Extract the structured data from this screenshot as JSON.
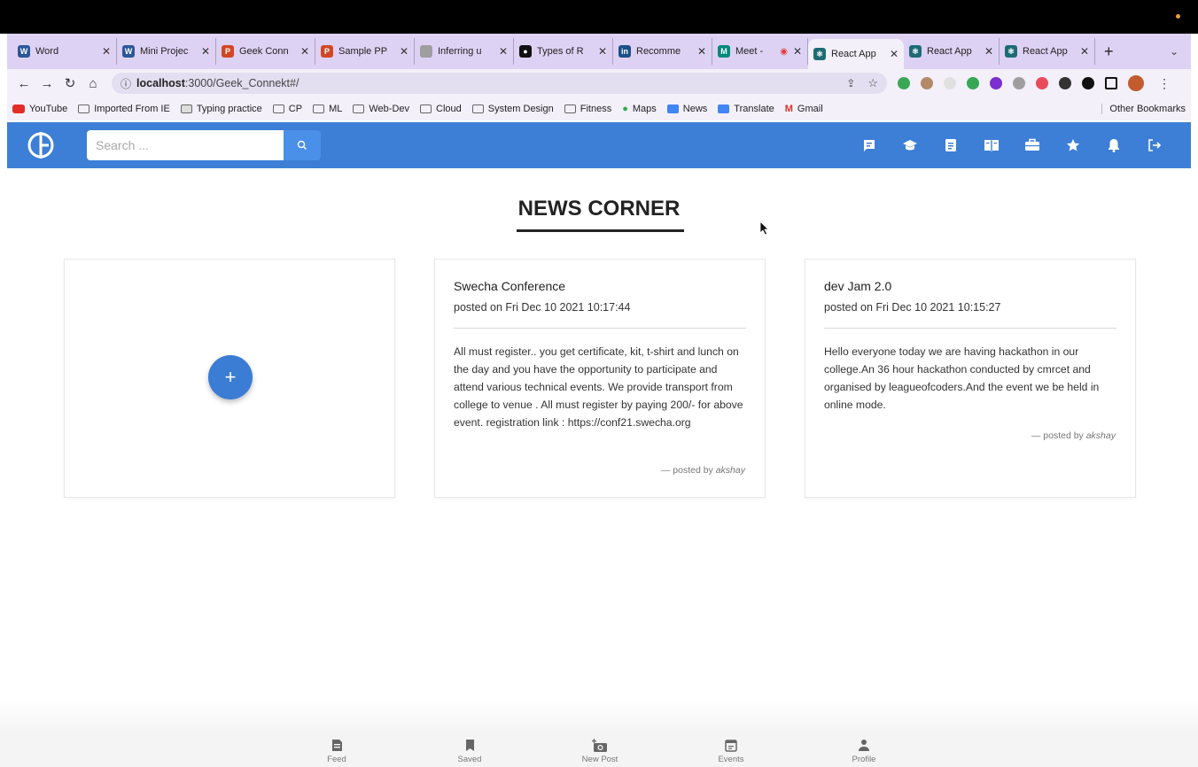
{
  "browser": {
    "tabs": [
      {
        "label": "Word",
        "color": "#2b579a",
        "letter": "W"
      },
      {
        "label": "Mini Projec",
        "color": "#2b579a",
        "letter": "W"
      },
      {
        "label": "Geek Conn",
        "color": "#d24726",
        "letter": "P"
      },
      {
        "label": "Sample PP",
        "color": "#d24726",
        "letter": "P"
      },
      {
        "label": "Inferring u",
        "color": "#888888",
        "letter": ""
      },
      {
        "label": "Types of R",
        "color": "#111111",
        "letter": "▪"
      },
      {
        "label": "Recomme",
        "color": "#1a4f8b",
        "letter": "in"
      },
      {
        "label": "Meet - ",
        "color": "#00897b",
        "letter": "M"
      },
      {
        "label": "React App",
        "color": "#1e6b75",
        "letter": "⚛",
        "active": true
      },
      {
        "label": "React App",
        "color": "#1e6b75",
        "letter": "⚛"
      },
      {
        "label": "React App",
        "color": "#1e6b75",
        "letter": "⚛"
      }
    ],
    "tab_close": "✕",
    "new_tab": "+",
    "url_host": "localhost",
    "url_path": ":3000/Geek_Connekt#/",
    "bookmarks": [
      "YouTube",
      "Imported From IE",
      "Typing practice",
      "CP",
      "ML",
      "Web-Dev",
      "Cloud",
      "System Design",
      "Fitness",
      "Maps",
      "News",
      "Translate",
      "Gmail"
    ],
    "other_bookmarks": "Other Bookmarks"
  },
  "app": {
    "logo_text": "GC",
    "search_placeholder": "Search ...",
    "accent": "#3d7fd6"
  },
  "page": {
    "title": "NEWS CORNER",
    "add_button": "+",
    "posts": [
      {
        "title": "Swecha Conference",
        "date": "posted on Fri Dec 10 2021 10:17:44",
        "body": "All must register.. you get certificate, kit, t-shirt and lunch on the day and you have the opportunity to participate and attend various technical events. We provide transport from college to venue . All must register by paying 200/- for above event. registration link : https://conf21.swecha.org",
        "posted_by_prefix": "— posted by ",
        "author": "akshay"
      },
      {
        "title": "dev Jam 2.0",
        "date": "posted on Fri Dec 10 2021 10:15:27",
        "body": "Hello everyone today we are having hackathon in our college.An 36 hour hackathon conducted by cmrcet and organised by leagueofcoders.And the event we be held in online mode.",
        "posted_by_prefix": "— posted by ",
        "author": "akshay"
      }
    ]
  },
  "bottom_nav": [
    {
      "label": "Feed",
      "icon": "feed-icon"
    },
    {
      "label": "Saved",
      "icon": "bookmark-icon"
    },
    {
      "label": "New Post",
      "icon": "camera-plus-icon"
    },
    {
      "label": "Events",
      "icon": "calendar-icon"
    },
    {
      "label": "Profile",
      "icon": "person-icon"
    }
  ]
}
